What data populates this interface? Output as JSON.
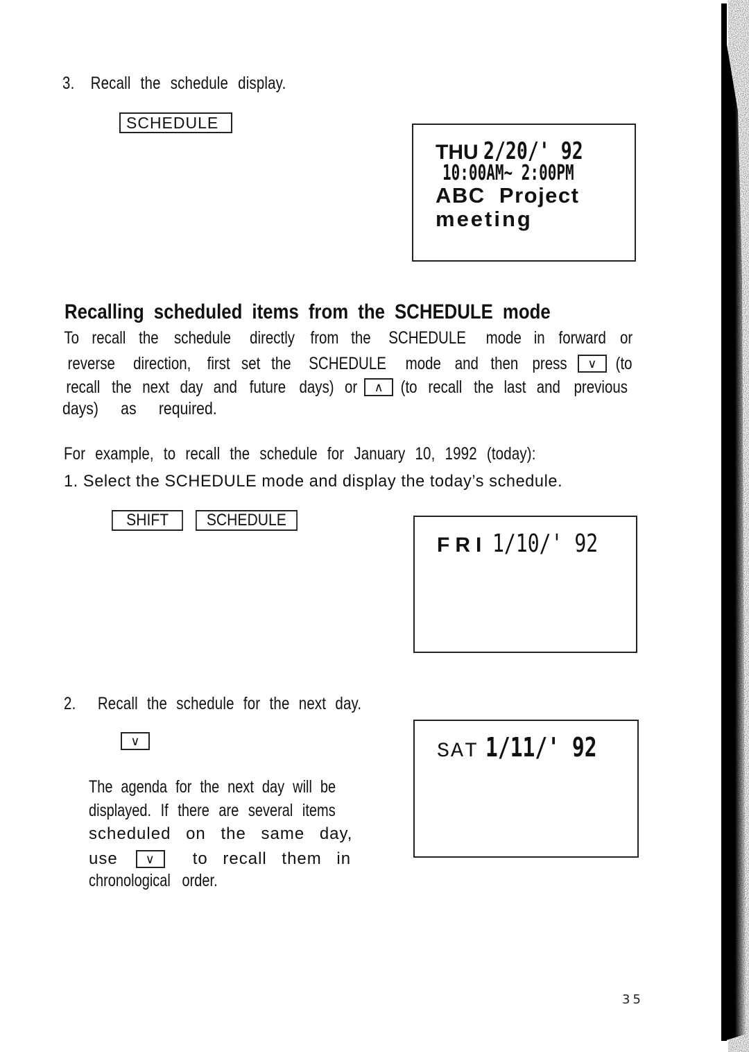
{
  "step3": {
    "number": "3.",
    "text": "Recall the schedule display.",
    "key_label": "SCHEDULE"
  },
  "display_thu": {
    "day": "THU",
    "date": "2/20/' 92",
    "time_range": "10:00AM~ 2:00PM",
    "title_line1": "ABC  Project",
    "title_line2": "meeting"
  },
  "section": {
    "heading": "Recalling scheduled items from the SCHEDULE mode",
    "para_line1": [
      "To",
      "recall",
      "the",
      "schedule",
      "directly",
      "from",
      "the",
      "SCHEDULE",
      "mode",
      "in",
      "forward",
      "or"
    ],
    "para_line2_text": [
      "reverse",
      "direction,",
      "first",
      "set",
      "the",
      "SCHEDULE",
      "mode",
      "and",
      "then",
      "press"
    ],
    "down_key": "∨",
    "para_line2_tail": "(to",
    "para_line3_text": [
      "recall",
      "the",
      "next",
      "day",
      "and",
      "future",
      "days)",
      "or"
    ],
    "up_key": "∧",
    "para_line3_tail": [
      "(to",
      "recall",
      "the",
      "last",
      "and",
      "previous"
    ],
    "para_line4": "days)  as  required."
  },
  "example": {
    "intro": "For example, to recall the schedule for January 10, 1992 (today):",
    "step1": "1. Select the SCHEDULE mode and display the today’s schedule.",
    "key_shift": "SHIFT",
    "key_schedule": "SCHEDULE"
  },
  "display_fri": {
    "day": "FRI",
    "date": "1/10/' 92"
  },
  "step2": {
    "number": "2.",
    "text": "Recall the schedule for the next day.",
    "key_label": "∨",
    "desc_line1": "The agenda for the next day will be",
    "desc_line2": "displayed. If there are several items",
    "desc_line3": "scheduled on the same day,",
    "desc_line4_pre": "use",
    "desc_line4_key": "∨",
    "desc_line4_post": "to recall them in",
    "desc_line5": "chronological   order."
  },
  "display_sat": {
    "day": "SAT",
    "date": "1/11/' 92"
  },
  "footer": {
    "page_number": "35"
  }
}
